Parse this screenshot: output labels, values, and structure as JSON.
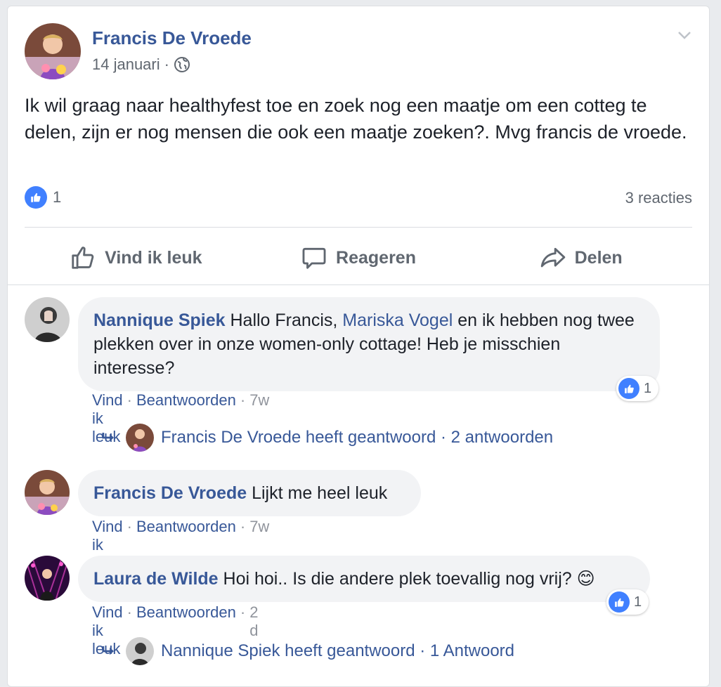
{
  "post": {
    "author": "Francis De Vroede",
    "date": "14 januari",
    "separator": "·",
    "audience_icon": "globe-icon",
    "text": "Ik wil graag naar healthyfest toe en zoek nog een maatje om een cotteg te delen, zijn er nog mensen die ook een maatje zoeken?. Mvg francis de vroede.",
    "likes": "1",
    "comments_count": "3 reacties"
  },
  "actions": {
    "like": "Vind ik leuk",
    "comment": "Reageren",
    "share": "Delen"
  },
  "comments": [
    {
      "author": "Nannique Spiek",
      "text_before": " Hallo Francis, ",
      "mention": "Mariska Vogel",
      "text_after": " en ik hebben nog twee plekken over in onze women-only cottage! Heb je misschien interesse?",
      "like_label": "Vind ik leuk",
      "reply_label": "Beantwoorden",
      "time": "7w",
      "reaction_count": "1",
      "replies_text": "Francis De Vroede heeft geantwoord · 2 antwoorden"
    },
    {
      "author": "Francis De Vroede",
      "text": " Lijkt me heel leuk",
      "like_label": "Vind ik leuk",
      "reply_label": "Beantwoorden",
      "time": "7w"
    },
    {
      "author": "Laura de Wilde",
      "text": " Hoi hoi.. Is die andere plek toevallig nog vrij? 😊",
      "like_label": "Vind ik leuk",
      "reply_label": "Beantwoorden",
      "time": "2 d",
      "reaction_count": "1",
      "replies_text": "Nannique Spiek heeft geantwoord · 1 Antwoord"
    }
  ],
  "dot": "·",
  "colors": {
    "link": "#385898",
    "like_blue": "#4080ff",
    "muted": "#606770",
    "bubble": "#f2f3f5"
  }
}
